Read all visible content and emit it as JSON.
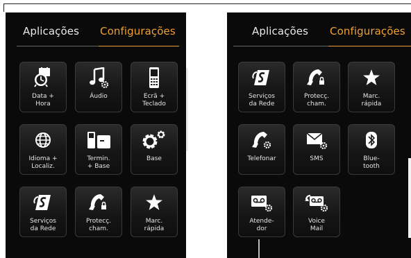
{
  "left_screen": {
    "tabs": {
      "apps": "Aplicações",
      "settings": "Configurações"
    },
    "tiles": [
      {
        "label": "Data +\nHora",
        "icon": "alarm-clock-calendar-icon"
      },
      {
        "label": "Áudio",
        "icon": "music-note-gear-icon"
      },
      {
        "label": "Ecrã +\nTeclado",
        "icon": "phone-keypad-icon"
      },
      {
        "label": "Idioma +\nLocaliz.",
        "icon": "globe-icon"
      },
      {
        "label": "Termin.\n+ Base",
        "icon": "handset-base-icon"
      },
      {
        "label": "Base",
        "icon": "gears-icon"
      },
      {
        "label": "Serviços\nda Rede",
        "icon": "network-services-icon"
      },
      {
        "label": "Protecç.\ncham.",
        "icon": "phone-lock-icon"
      },
      {
        "label": "Marc.\nrápida",
        "icon": "star-icon"
      }
    ]
  },
  "right_screen": {
    "tabs": {
      "apps": "Aplicações",
      "settings": "Configurações"
    },
    "tiles": [
      {
        "label": "Serviços\nda Rede",
        "icon": "network-services-icon"
      },
      {
        "label": "Protecç.\ncham.",
        "icon": "phone-lock-icon"
      },
      {
        "label": "Marc.\nrápida",
        "icon": "star-icon"
      },
      {
        "label": "Telefonar",
        "icon": "phone-gear-icon"
      },
      {
        "label": "SMS",
        "icon": "envelope-gear-icon"
      },
      {
        "label": "Blue-\ntooth",
        "icon": "bluetooth-icon"
      },
      {
        "label": "Atende-\ndor",
        "icon": "answering-machine-gear-icon"
      },
      {
        "label": "Voice\nMail",
        "icon": "voicemail-gear-icon"
      }
    ]
  },
  "colors": {
    "accent": "#f0a030",
    "background": "#0a0a0a",
    "text": "#e6e6e6"
  }
}
